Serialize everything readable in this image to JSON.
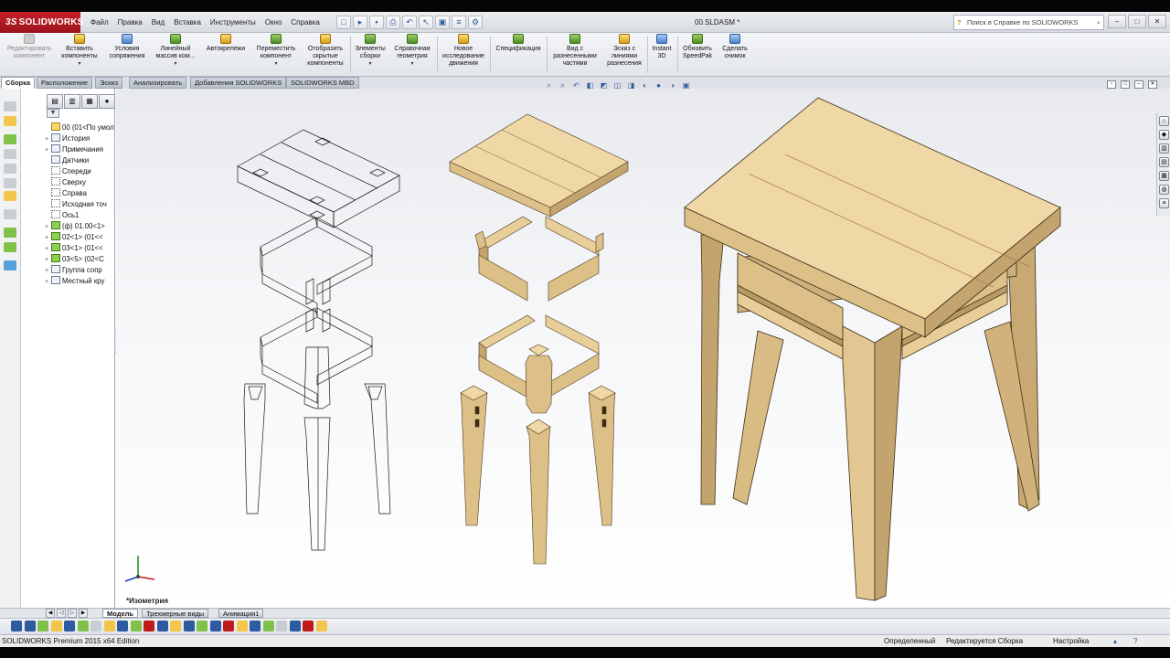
{
  "app": {
    "logo": "SOLIDWORKS",
    "document_title": "00.SLDASM *"
  },
  "menu": [
    "Файл",
    "Правка",
    "Вид",
    "Вставка",
    "Инструменты",
    "Окно",
    "Справка"
  ],
  "search": {
    "placeholder": "Поиск в Справке по SOLIDWORKS"
  },
  "command_manager": [
    {
      "label": "Редактировать компонент",
      "icon": "edit-component-icon",
      "enabled": false
    },
    {
      "label": "Вставить компоненты",
      "icon": "insert-components-icon",
      "dropdown": true
    },
    {
      "label": "Условия сопряжения",
      "icon": "mate-icon"
    },
    {
      "label": "Линейный массив ком...",
      "icon": "linear-pattern-icon",
      "dropdown": true
    },
    {
      "label": "Автокрепежи",
      "icon": "smart-fasteners-icon"
    },
    {
      "label": "Переместить компонент",
      "icon": "move-component-icon",
      "dropdown": true
    },
    {
      "label": "Отобразить скрытые компоненты",
      "icon": "show-hidden-icon"
    },
    {
      "label": "Элементы сборки",
      "icon": "assembly-features-icon",
      "dropdown": true
    },
    {
      "label": "Справочная геометрия",
      "icon": "reference-geometry-icon",
      "dropdown": true
    },
    {
      "label": "Новое исследование движения",
      "icon": "motion-study-icon"
    },
    {
      "label": "Спецификация",
      "icon": "bom-icon"
    },
    {
      "label": "Вид с разнесенными частями",
      "icon": "exploded-view-icon"
    },
    {
      "label": "Эскиз с линиями разнесения",
      "icon": "explode-line-sketch-icon"
    },
    {
      "label": "Instant 3D",
      "icon": "instant3d-icon"
    },
    {
      "label": "Обновить SpeedPak",
      "icon": "speedpak-icon"
    },
    {
      "label": "Сделать снимок",
      "icon": "snapshot-icon"
    }
  ],
  "cm_tabs": [
    {
      "label": "Сборка",
      "active": true
    },
    {
      "label": "Расположение"
    },
    {
      "label": "Эскиз"
    },
    {
      "label": "Анализировать"
    },
    {
      "label": "Добавления SOLIDWORKS"
    },
    {
      "label": "SOLIDWORKS MBD"
    }
  ],
  "tree": [
    {
      "label": "00  (01<По умол",
      "icon": "assembly-icon",
      "expander": ""
    },
    {
      "label": "История",
      "icon": "history-icon",
      "expander": "+"
    },
    {
      "label": "Примечания",
      "icon": "annotations-icon",
      "expander": "+"
    },
    {
      "label": "Датчики",
      "icon": "sensors-icon",
      "expander": ""
    },
    {
      "label": "Спереди",
      "icon": "plane-icon",
      "expander": ""
    },
    {
      "label": "Сверху",
      "icon": "plane-icon",
      "expander": ""
    },
    {
      "label": "Справа",
      "icon": "plane-icon",
      "expander": ""
    },
    {
      "label": "Исходная точ",
      "icon": "origin-icon",
      "expander": ""
    },
    {
      "label": "Ось1",
      "icon": "axis-icon",
      "expander": ""
    },
    {
      "label": "(ф) 01.00<1>",
      "icon": "part-icon",
      "expander": "+"
    },
    {
      "label": "02<1> (01<<",
      "icon": "part-icon",
      "expander": "+"
    },
    {
      "label": "03<1> (01<<",
      "icon": "part-icon",
      "expander": "+"
    },
    {
      "label": "03<5> (02<С",
      "icon": "part-icon",
      "expander": "+"
    },
    {
      "label": "Группа сопр",
      "icon": "mates-icon",
      "expander": "+"
    },
    {
      "label": "Местный кру",
      "icon": "pattern-icon",
      "expander": "+"
    }
  ],
  "viewport": {
    "view_label": "*Изометрия",
    "wood_light": "#f0d8a6",
    "wood_mid": "#ddbf88",
    "wood_dark": "#c3a46e"
  },
  "model_tabs": [
    {
      "label": "Модель",
      "active": true
    },
    {
      "label": "Трехмерные виды"
    },
    {
      "label": "Анимация1"
    }
  ],
  "status": {
    "edition": "SOLIDWORKS Premium 2015 x64 Edition",
    "defined": "Определенный",
    "editing": "Редактируется Сборка",
    "settings": "Настройка"
  }
}
